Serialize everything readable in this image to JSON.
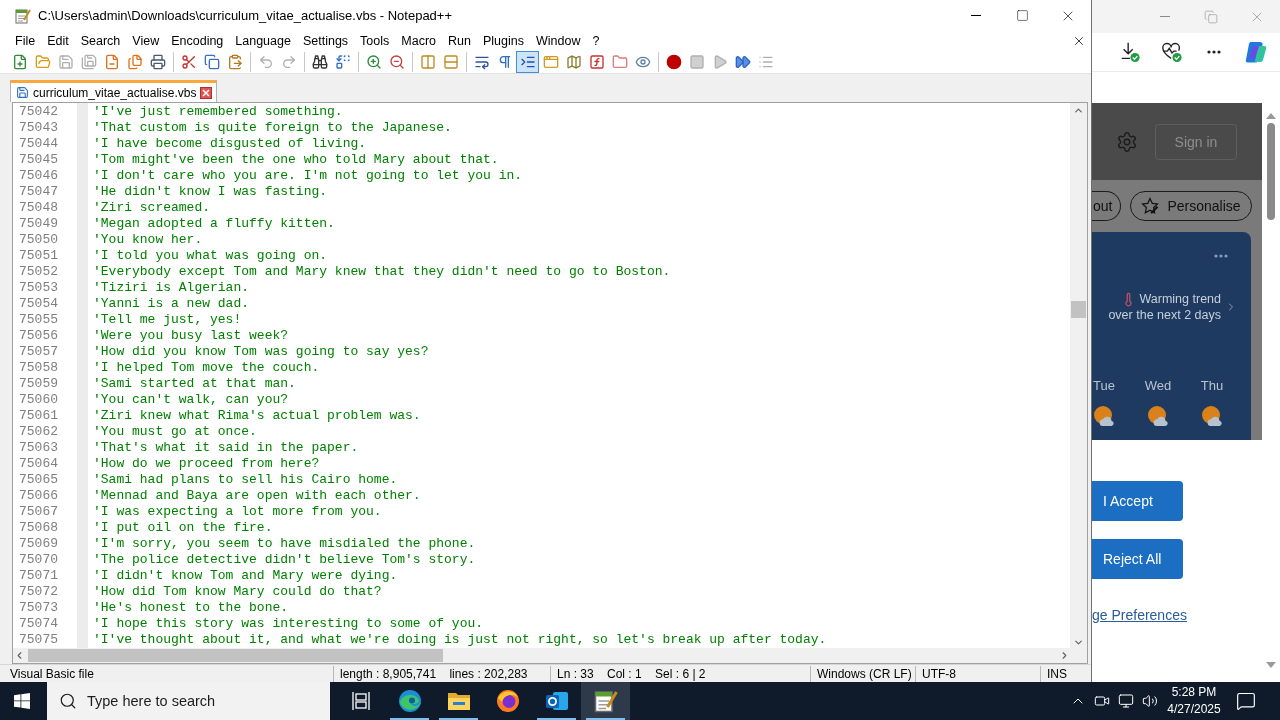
{
  "notepad": {
    "title": "C:\\Users\\admin\\Downloads\\curriculum_vitae_actualise.vbs - Notepad++",
    "menu": [
      "File",
      "Edit",
      "Search",
      "View",
      "Encoding",
      "Language",
      "Settings",
      "Tools",
      "Macro",
      "Run",
      "Plugins",
      "Window",
      "?"
    ],
    "toolbar": [
      {
        "pressed": false,
        "disabled": false
      },
      {
        "pressed": false,
        "disabled": false
      },
      {
        "pressed": false,
        "disabled": true
      },
      {
        "pressed": false,
        "disabled": true
      },
      {
        "pressed": false,
        "disabled": false
      },
      {
        "pressed": false,
        "disabled": false
      },
      {
        "pressed": false,
        "disabled": false
      },
      {
        "pressed": false,
        "disabled": false
      },
      {
        "pressed": false,
        "disabled": false
      },
      {
        "pressed": false,
        "disabled": false
      },
      {
        "pressed": false,
        "disabled": true
      },
      {
        "pressed": false,
        "disabled": true
      },
      {
        "pressed": false,
        "disabled": false
      },
      {
        "pressed": false,
        "disabled": false
      },
      {
        "pressed": false,
        "disabled": false
      },
      {
        "pressed": false,
        "disabled": false
      },
      {
        "pressed": false,
        "disabled": false
      },
      {
        "pressed": false,
        "disabled": false
      },
      {
        "pressed": false,
        "disabled": false
      },
      {
        "pressed": false,
        "disabled": false
      },
      {
        "pressed": true,
        "disabled": false
      },
      {
        "pressed": false,
        "disabled": false
      },
      {
        "pressed": false,
        "disabled": false
      },
      {
        "pressed": false,
        "disabled": false
      },
      {
        "pressed": false,
        "disabled": false
      },
      {
        "pressed": false,
        "disabled": false
      },
      {
        "pressed": false,
        "disabled": false
      },
      {
        "pressed": false,
        "disabled": true
      },
      {
        "pressed": false,
        "disabled": true
      },
      {
        "pressed": false,
        "disabled": false
      },
      {
        "pressed": false,
        "disabled": true
      }
    ],
    "tabs": [
      {
        "label": "curriculum_vitae_actualise.vbs",
        "selected": true
      }
    ],
    "lines": [
      {
        "number": "75042",
        "text": "'I've just remembered something."
      },
      {
        "number": "75043",
        "text": "'That custom is quite foreign to the Japanese."
      },
      {
        "number": "75044",
        "text": "'I have become disgusted of living."
      },
      {
        "number": "75045",
        "text": "'Tom might've been the one who told Mary about that."
      },
      {
        "number": "75046",
        "text": "'I don't care who you are. I'm not going to let you in."
      },
      {
        "number": "75047",
        "text": "'He didn't know I was fasting."
      },
      {
        "number": "75048",
        "text": "'Ziri screamed."
      },
      {
        "number": "75049",
        "text": "'Megan adopted a fluffy kitten."
      },
      {
        "number": "75050",
        "text": "'You know her."
      },
      {
        "number": "75051",
        "text": "'I told you what was going on."
      },
      {
        "number": "75052",
        "text": "'Everybody except Tom and Mary knew that they didn't need to go to Boston."
      },
      {
        "number": "75053",
        "text": "'Tiziri is Algerian."
      },
      {
        "number": "75054",
        "text": "'Yanni is a new dad."
      },
      {
        "number": "75055",
        "text": "'Tell me just, yes!"
      },
      {
        "number": "75056",
        "text": "'Were you busy last week?"
      },
      {
        "number": "75057",
        "text": "'How did you know Tom was going to say yes?"
      },
      {
        "number": "75058",
        "text": "'I helped Tom move the couch."
      },
      {
        "number": "75059",
        "text": "'Sami started at that man."
      },
      {
        "number": "75060",
        "text": "'You can't walk, can you?"
      },
      {
        "number": "75061",
        "text": "'Ziri knew what Rima's actual problem was."
      },
      {
        "number": "75062",
        "text": "'You must go at once."
      },
      {
        "number": "75063",
        "text": "'That's what it said in the paper."
      },
      {
        "number": "75064",
        "text": "'How do we proceed from here?"
      },
      {
        "number": "75065",
        "text": "'Sami had plans to sell his Cairo home."
      },
      {
        "number": "75066",
        "text": "'Mennad and Baya are open with each other."
      },
      {
        "number": "75067",
        "text": "'I was expecting a lot more from you."
      },
      {
        "number": "75068",
        "text": "'I put oil on the fire."
      },
      {
        "number": "75069",
        "text": "'I'm sorry, you seem to have misdialed the phone."
      },
      {
        "number": "75070",
        "text": "'The police detective didn't believe Tom's story."
      },
      {
        "number": "75071",
        "text": "'I didn't know Tom and Mary were dying."
      },
      {
        "number": "75072",
        "text": "'How did Tom know Mary could do that?"
      },
      {
        "number": "75073",
        "text": "'He's honest to the bone."
      },
      {
        "number": "75074",
        "text": "'I hope this story was interesting to some of you."
      },
      {
        "number": "75075",
        "text": "'I've thought about it, and what we're doing is just not right, so let's break up after today."
      }
    ],
    "status_bar": [
      "Visual Basic file",
      "length : 8,905,741    lines : 202,283",
      "Ln : 33    Col : 1    Sel : 6 | 2",
      "Windows (CR LF)",
      "UTF-8",
      "INS"
    ]
  },
  "browser": {
    "sign_in": "Sign in",
    "chips": [
      {
        "label": "out",
        "kind": "clipped"
      },
      {
        "label": "Personalise",
        "kind": "with_icon"
      }
    ],
    "weather": {
      "headline": "Warming trend",
      "detail": "over the next 2 days",
      "days": [
        "Tue",
        "Wed",
        "Thu"
      ]
    },
    "consent": {
      "buttons": [
        "I Accept",
        "Reject All"
      ],
      "link": "ge Preferences"
    }
  },
  "taskbar": {
    "search": {
      "placeholder": "Type here to search"
    },
    "apps": [
      {
        "running": true,
        "selected": false
      },
      {
        "running": true,
        "selected": false
      },
      {
        "running": false,
        "selected": false
      },
      {
        "running": true,
        "selected": false
      },
      {
        "running": true,
        "selected": true
      }
    ],
    "clock": {
      "time": "5:28 PM",
      "date": "4/27/2025"
    }
  }
}
